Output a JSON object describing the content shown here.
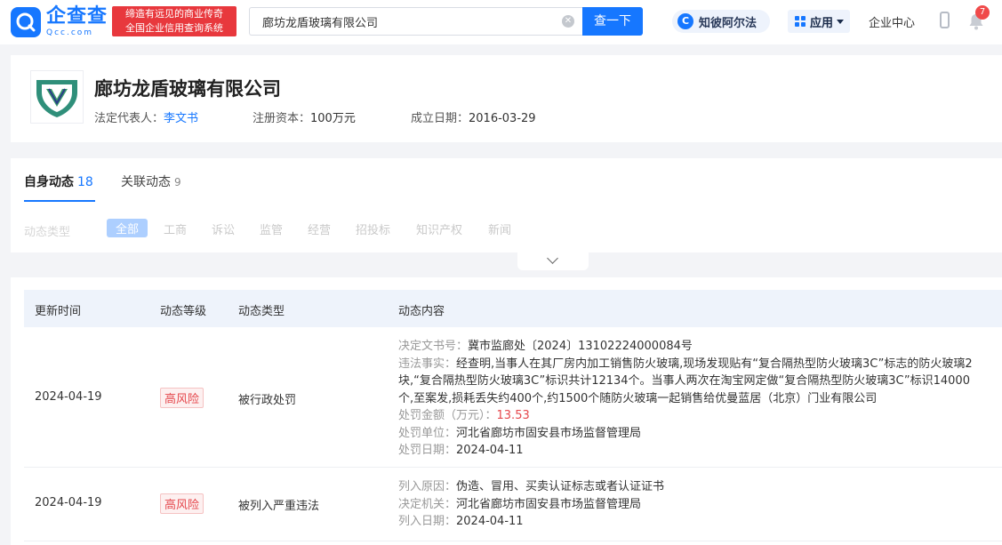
{
  "header": {
    "logo_cn": "企查查",
    "logo_en": "Qcc.com",
    "slogan_line1": "缔造有远见的商业传奇",
    "slogan_line2": "全国企业信用查询系统",
    "search_value": "廊坊龙盾玻璃有限公司",
    "search_button": "查一下",
    "zhibi_label": "知彼阿尔法",
    "app_label": "应用",
    "enterprise_center": "企业中心",
    "notification_count": "7"
  },
  "company": {
    "name": "廊坊龙盾玻璃有限公司",
    "legal_rep_label": "法定代表人：",
    "legal_rep": "李文书",
    "capital_label": "注册资本：",
    "capital": "100万元",
    "founded_label": "成立日期：",
    "founded": "2016-03-29"
  },
  "tabs": [
    {
      "label": "自身动态",
      "count": "18"
    },
    {
      "label": "关联动态",
      "count": "9"
    }
  ],
  "filters": {
    "label": "动态类型",
    "chips": [
      "全部",
      "工商",
      "诉讼",
      "监管",
      "经营",
      "招投标",
      "知识产权",
      "新闻"
    ]
  },
  "table": {
    "headers": [
      "更新时间",
      "动态等级",
      "动态类型",
      "动态内容"
    ],
    "rows": [
      {
        "date": "2024-04-19",
        "level": "高风险",
        "type": "被行政处罚",
        "doc_no_label": "决定文书号：",
        "doc_no": "冀市监廊处〔2024〕13102224000084号",
        "facts_label": "违法事实：",
        "facts": "经查明,当事人在其厂房内加工销售防火玻璃,现场发现贴有“复合隔热型防火玻璃3C”标志的防火玻璃2块,“复合隔热型防火玻璃3C”标识共计12134个。当事人两次在淘宝网定做“复合隔热型防火玻璃3C”标识14000个,至案发,损耗丢失约400个,约1500个随防火玻璃一起销售给优曼蓝居（北京）门业有限公司",
        "amount_label": "处罚金额（万元）：",
        "amount": "13.53",
        "unit_label": "处罚单位：",
        "unit": "河北省廊坊市固安县市场监督管理局",
        "pdate_label": "处罚日期：",
        "pdate": "2024-04-11"
      },
      {
        "date": "2024-04-19",
        "level": "高风险",
        "type": "被列入严重违法",
        "reason_label": "列入原因：",
        "reason": "伪造、冒用、买卖认证标志或者认证证书",
        "org_label": "决定机关：",
        "org": "河北省廊坊市固安县市场监督管理局",
        "ldate_label": "列入日期：",
        "ldate": "2024-04-11"
      }
    ]
  }
}
